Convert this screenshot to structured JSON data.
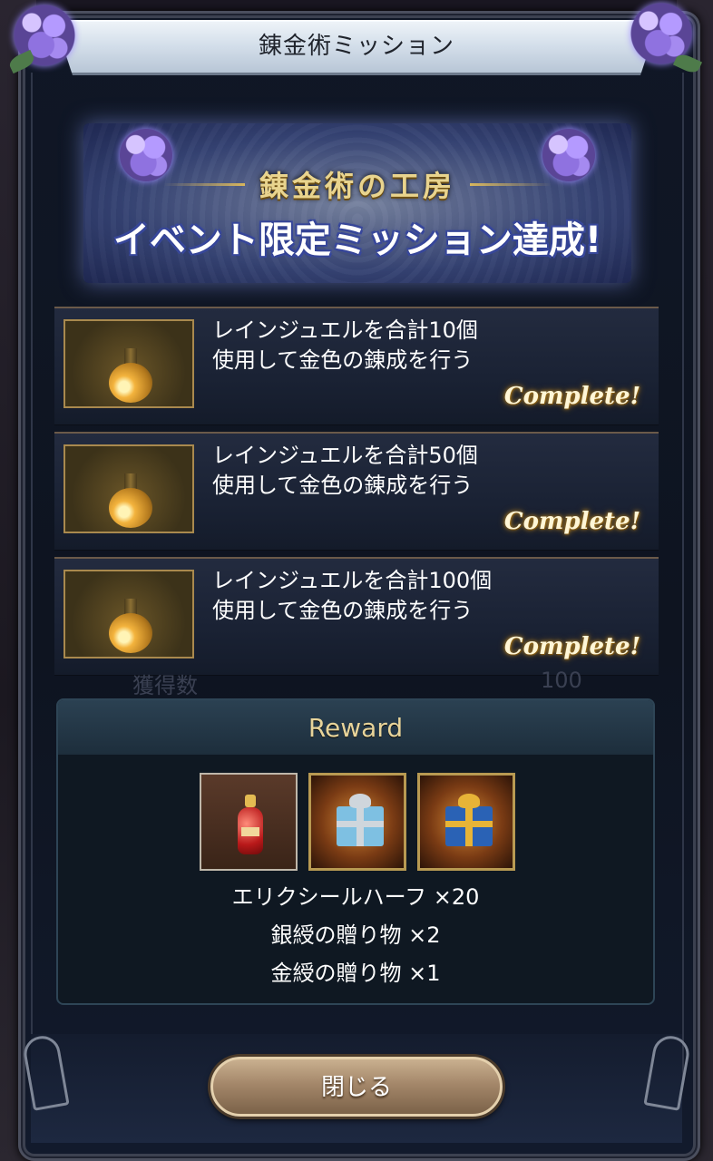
{
  "window": {
    "title": "錬金術ミッション"
  },
  "banner": {
    "subtitle": "錬金術の工房",
    "headline": "イベント限定ミッション達成!"
  },
  "missions": [
    {
      "line1": "レインジュエルを合計10個",
      "line2": "使用して金色の錬成を行う",
      "status": "Complete!"
    },
    {
      "line1": "レインジュエルを合計50個",
      "line2": "使用して金色の錬成を行う",
      "status": "Complete!"
    },
    {
      "line1": "レインジュエルを合計100個",
      "line2": "使用して金色の錬成を行う",
      "status": "Complete!"
    }
  ],
  "background_hint": {
    "left": "獲得数",
    "right": "100"
  },
  "reward": {
    "title": "Reward",
    "items": [
      {
        "icon": "elixir-half-icon",
        "text": "エリクシールハーフ ×20"
      },
      {
        "icon": "silver-gift-icon",
        "text": "銀綬の贈り物 ×2"
      },
      {
        "icon": "gold-gift-icon",
        "text": "金綬の贈り物 ×1"
      }
    ]
  },
  "footer": {
    "close_label": "閉じる"
  },
  "colors": {
    "frame": "#0e1420",
    "title_bar": "#d2dde9",
    "complete_glow": "#b88a2c",
    "reward_title": "#e8d49a",
    "button": "#a4876a"
  }
}
